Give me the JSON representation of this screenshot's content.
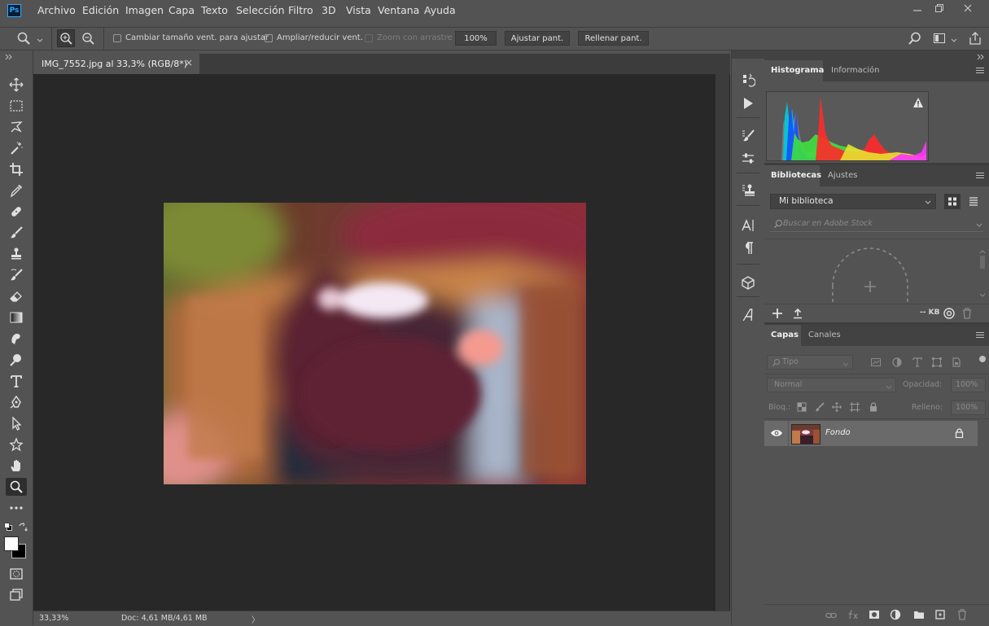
{
  "app": {
    "logo": "Ps",
    "menu": [
      "Archivo",
      "Edición",
      "Imagen",
      "Capa",
      "Texto",
      "Selección",
      "Filtro",
      "3D",
      "Vista",
      "Ventana",
      "Ayuda"
    ]
  },
  "options": {
    "resize_windows_label": "Cambiar tamaño vent. para ajustar",
    "zoom_all_label": "Ampliar/reducir vent.",
    "scrubby_zoom_label": "Zoom con arrastre",
    "zoom_100_label": "100%",
    "fit_screen_label": "Ajustar pant.",
    "fill_screen_label": "Rellenar pant."
  },
  "document": {
    "tab_title": "IMG_7552.jpg al 33,3% (RGB/8*)",
    "close_glyph": "×"
  },
  "status": {
    "zoom": "33,33%",
    "doc_info": "Doc: 4,61 MB/4,61 MB",
    "arrow": "〉"
  },
  "panels": {
    "histogram": {
      "tab_active": "Histograma",
      "tab_inactive": "Información"
    },
    "libraries": {
      "tab_active": "Bibliotecas",
      "tab_inactive": "Ajustes",
      "library_select": "Mi biblioteca",
      "search_placeholder": "Buscar en Adobe Stock",
      "size_text": "-- KB"
    },
    "layers": {
      "tab_active": "Capas",
      "tab_inactive": "Canales",
      "filter_kind": "Tipo",
      "blend_mode": "Normal",
      "opacity_label": "Opacidad:",
      "opacity_value": "100%",
      "lock_label": "Bloq.:",
      "fill_label": "Relleno:",
      "fill_value": "100%",
      "layer_name": "Fondo"
    }
  },
  "colors": {
    "ui_bg": "#535353",
    "canvas_bg": "#282828",
    "foreground": "#ffffff",
    "background": "#000000"
  }
}
